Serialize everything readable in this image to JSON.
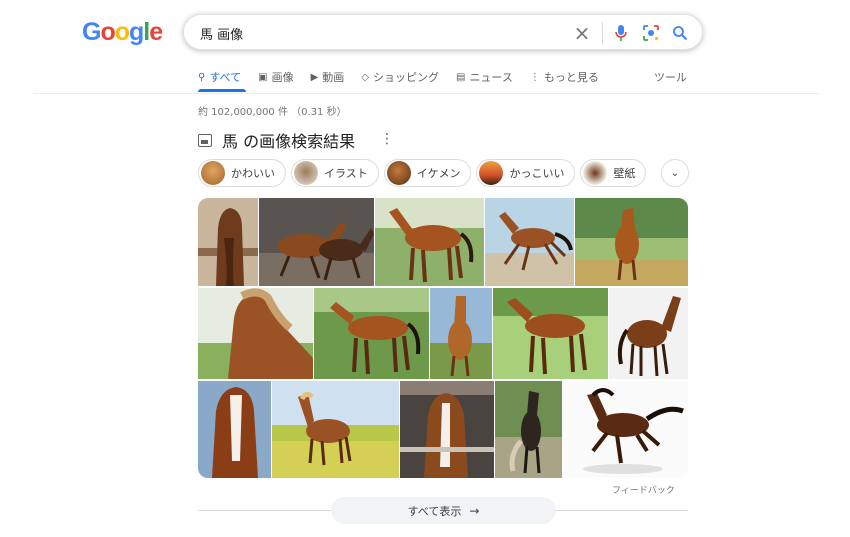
{
  "logo": {
    "letters": [
      "G",
      "o",
      "o",
      "g",
      "l",
      "e"
    ]
  },
  "search": {
    "query": "馬 画像"
  },
  "tabs": [
    {
      "label": "すべて",
      "icon": "search-icon"
    },
    {
      "label": "画像",
      "icon": "image-icon"
    },
    {
      "label": "動画",
      "icon": "video-icon"
    },
    {
      "label": "ショッピング",
      "icon": "tag-icon"
    },
    {
      "label": "ニュース",
      "icon": "news-icon"
    },
    {
      "label": "もっと見る",
      "icon": "more-vert-icon"
    }
  ],
  "tools_label": "ツール",
  "stats": "約 102,000,000 件 （0.31 秒）",
  "section": {
    "title": "馬 の画像検索結果"
  },
  "chips": [
    "かわいい",
    "イラスト",
    "イケメン",
    "かっこいい",
    "壁紙"
  ],
  "feedback": "フィードバック",
  "show_all": "すべて表示",
  "colors": {
    "accent": "#1a73e8",
    "horse": "#8b4a1e",
    "grass": "#6b8e3a"
  }
}
